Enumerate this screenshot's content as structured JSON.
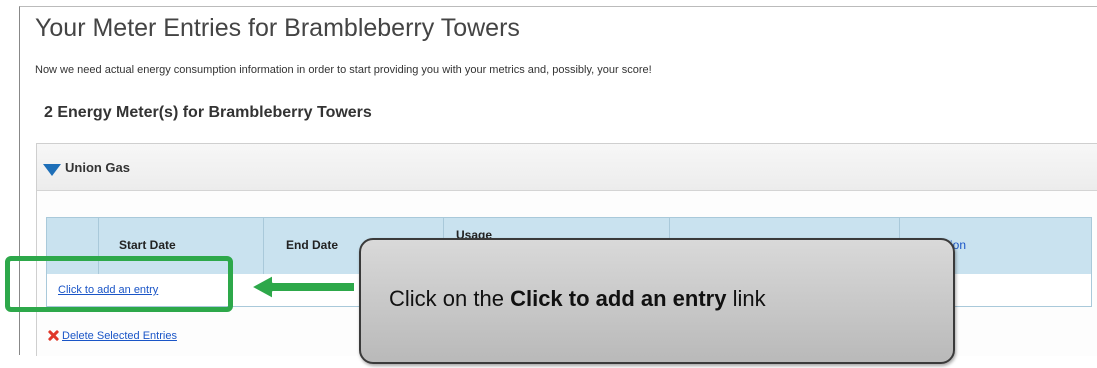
{
  "page": {
    "title": "Your Meter Entries for Brambleberry Towers",
    "intro": "Now we need actual energy consumption information in order to start providing you with your metrics and, possibly, your score!",
    "meters_heading": "2 Energy Meter(s) for Brambleberry Towers"
  },
  "meter": {
    "name": "Union Gas",
    "expanded": true,
    "columns": [
      {
        "label": ""
      },
      {
        "label": "Start Date"
      },
      {
        "label": "End Date"
      },
      {
        "label": "Usage"
      },
      {
        "label": ""
      },
      {
        "label": "Estimation"
      }
    ],
    "add_entry_label": "Click to add an entry",
    "delete_label": "Delete Selected Entries"
  },
  "callout": {
    "prefix": "Click on the",
    "emphasis": "Click to add an entry",
    "suffix": "link"
  },
  "colors": {
    "highlight_green": "#2da84a",
    "header_blue": "#c9e2ef",
    "link_blue": "#1a55c7",
    "caret_blue": "#1e6fb8",
    "delete_red": "#e0382a"
  },
  "icons": [
    "expand-caret-icon",
    "delete-x-icon",
    "arrow-left-icon"
  ]
}
